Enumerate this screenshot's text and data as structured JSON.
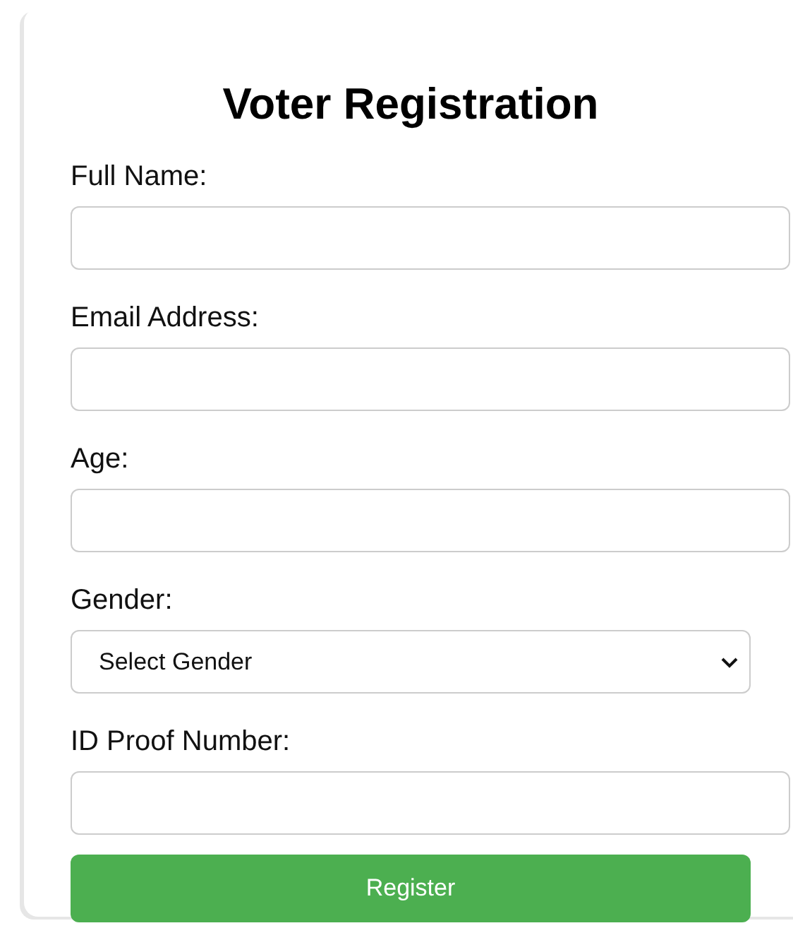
{
  "form": {
    "title": "Voter Registration",
    "fields": [
      {
        "label": "Full Name:",
        "kind": "input"
      },
      {
        "label": "Email Address:",
        "kind": "input"
      },
      {
        "label": "Age:",
        "kind": "input"
      },
      {
        "label": "Gender:",
        "kind": "select",
        "value": "Select Gender"
      },
      {
        "label": "ID Proof Number:",
        "kind": "input"
      }
    ],
    "submit": "Register"
  }
}
